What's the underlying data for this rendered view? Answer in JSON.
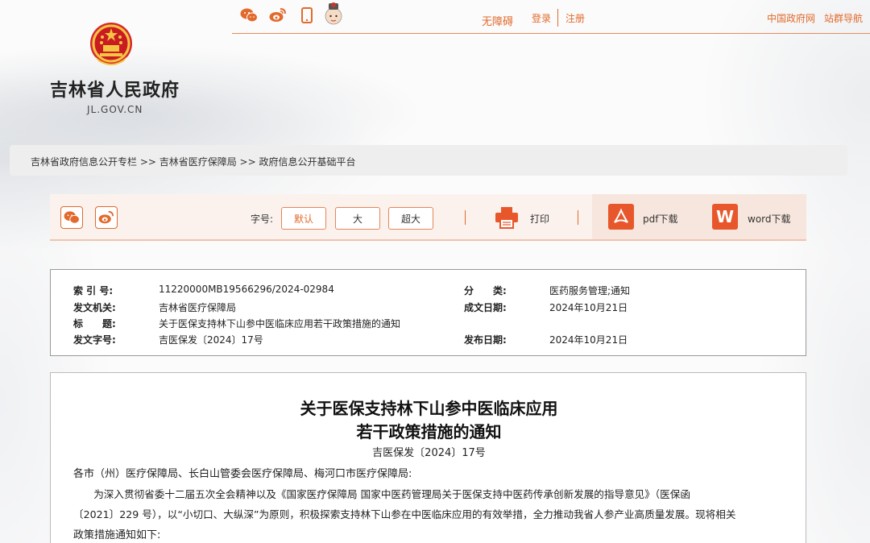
{
  "header": {
    "site_title": "吉林省人民政府",
    "site_domain": "JL.GOV.CN",
    "accessible": "无障碍",
    "login": "登录",
    "register": "注册",
    "gov_link": "中国政府网",
    "site_nav": "站群导航",
    "icons": [
      "wechat-icon",
      "weibo-icon",
      "mobile-icon",
      "avatar-icon"
    ]
  },
  "breadcrumb": "吉林省政府信息公开专栏 >> 吉林省医疗保障局 >> 政府信息公开基础平台",
  "toolbar": {
    "font_label": "字号:",
    "font_default": "默认",
    "font_large": "大",
    "font_xlarge": "超大",
    "print": "打印",
    "pdf": "pdf下载",
    "word": "word下载",
    "word_glyph": "W"
  },
  "meta": {
    "index_key": "索 引 号:",
    "index_val": "11220000MB19566296/2024-02984",
    "category_key": "分　　类:",
    "category_val": "医药服务管理;通知",
    "issuer_key": "发文机关:",
    "issuer_val": "吉林省医疗保障局",
    "written_key": "成文日期:",
    "written_val": "2024年10月21日",
    "title_key": "标　　题:",
    "title_val": "关于医保支持林下山参中医临床应用若干政策措施的通知",
    "docno_key": "发文字号:",
    "docno_val": "吉医保发〔2024〕17号",
    "published_key": "发布日期:",
    "published_val": "2024年10月21日"
  },
  "article": {
    "title_line1": "关于医保支持林下山参中医临床应用",
    "title_line2": "若干政策措施的通知",
    "doc_no": "吉医保发〔2024〕17号",
    "addressee": "各市（州）医疗保障局、长白山管委会医疗保障局、梅河口市医疗保障局:",
    "para1_line1": "　　为深入贯彻省委十二届五次全会精神以及《国家医疗保障局 国家中医药管理局关于医保支持中医药传承创新发展的指导意见》（医保函",
    "para1_line2": "〔2021〕229 号），以“小切口、大纵深”为原则，积极探索支持林下山参在中医临床应用的有效举措，全力推动我省人参产业高质量发展。现将相关",
    "para1_line3": "政策措施通知如下:"
  },
  "colors": {
    "accent": "#e26a2c",
    "toolbar_bg": "#fbf2ed",
    "download_bg": "#f7e6dd"
  }
}
